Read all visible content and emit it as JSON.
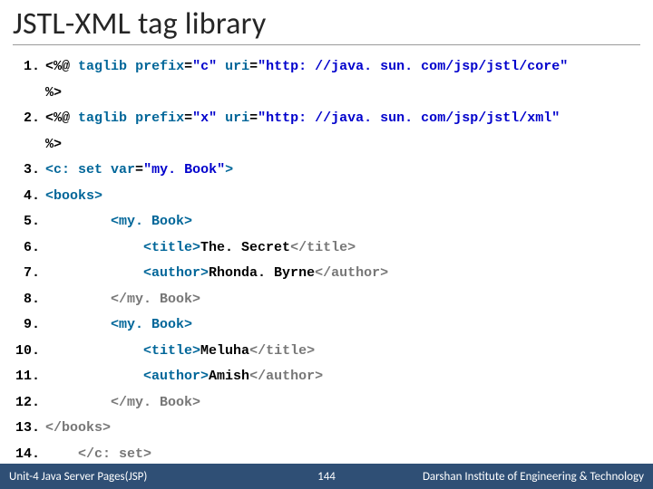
{
  "slide": {
    "title": "JSTL-XML tag library"
  },
  "code": {
    "lines": [
      {
        "n": "1.",
        "indent": 0,
        "segs": [
          {
            "t": "<%@",
            "c": "txt"
          },
          {
            "t": " ",
            "c": "txt"
          },
          {
            "t": "taglib",
            "c": "kw"
          },
          {
            "t": " ",
            "c": "txt"
          },
          {
            "t": "prefix",
            "c": "kw"
          },
          {
            "t": "=",
            "c": "txt"
          },
          {
            "t": "\"c\"",
            "c": "str"
          },
          {
            "t": " ",
            "c": "txt"
          },
          {
            "t": "uri",
            "c": "kw"
          },
          {
            "t": "=",
            "c": "txt"
          },
          {
            "t": "\"http: //java. sun. com/jsp/jstl/core\"",
            "c": "str"
          }
        ]
      },
      {
        "n": "",
        "indent": 0,
        "segs": [
          {
            "t": "%>",
            "c": "txt"
          }
        ]
      },
      {
        "n": "2.",
        "indent": 0,
        "segs": [
          {
            "t": "<%@",
            "c": "txt"
          },
          {
            "t": " ",
            "c": "txt"
          },
          {
            "t": "taglib",
            "c": "kw"
          },
          {
            "t": " ",
            "c": "txt"
          },
          {
            "t": "prefix",
            "c": "kw"
          },
          {
            "t": "=",
            "c": "txt"
          },
          {
            "t": "\"x\"",
            "c": "str"
          },
          {
            "t": " ",
            "c": "txt"
          },
          {
            "t": "uri",
            "c": "kw"
          },
          {
            "t": "=",
            "c": "txt"
          },
          {
            "t": "\"http: //java. sun. com/jsp/jstl/xml\"",
            "c": "str"
          }
        ]
      },
      {
        "n": "",
        "indent": 0,
        "segs": [
          {
            "t": "%>",
            "c": "txt"
          }
        ]
      },
      {
        "n": "3.",
        "indent": 0,
        "segs": [
          {
            "t": "<c: set",
            "c": "tag"
          },
          {
            "t": " ",
            "c": "txt"
          },
          {
            "t": "var",
            "c": "kw"
          },
          {
            "t": "=",
            "c": "txt"
          },
          {
            "t": "\"my. Book\"",
            "c": "str"
          },
          {
            "t": ">",
            "c": "tag"
          }
        ]
      },
      {
        "n": "4.",
        "indent": 0,
        "segs": [
          {
            "t": "<books>",
            "c": "tag"
          }
        ]
      },
      {
        "n": "5.",
        "indent": 2,
        "segs": [
          {
            "t": "<my. Book>",
            "c": "tag"
          }
        ]
      },
      {
        "n": "6.",
        "indent": 3,
        "segs": [
          {
            "t": "<title>",
            "c": "tag"
          },
          {
            "t": "The. Secret",
            "c": "txt"
          },
          {
            "t": "</title>",
            "c": "grey"
          }
        ]
      },
      {
        "n": "7.",
        "indent": 3,
        "segs": [
          {
            "t": "<author>",
            "c": "tag"
          },
          {
            "t": "Rhonda. Byrne",
            "c": "txt"
          },
          {
            "t": "</author>",
            "c": "grey"
          }
        ]
      },
      {
        "n": "8.",
        "indent": 2,
        "segs": [
          {
            "t": "</my. Book>",
            "c": "grey"
          }
        ]
      },
      {
        "n": "9.",
        "indent": 2,
        "segs": [
          {
            "t": "<my. Book>",
            "c": "tag"
          }
        ]
      },
      {
        "n": "10.",
        "indent": 3,
        "segs": [
          {
            "t": "<title>",
            "c": "tag"
          },
          {
            "t": "Meluha",
            "c": "txt"
          },
          {
            "t": "</title>",
            "c": "grey"
          }
        ]
      },
      {
        "n": "11.",
        "indent": 3,
        "segs": [
          {
            "t": "<author>",
            "c": "tag"
          },
          {
            "t": "Amish",
            "c": "txt"
          },
          {
            "t": "</author>",
            "c": "grey"
          }
        ]
      },
      {
        "n": "12.",
        "indent": 2,
        "segs": [
          {
            "t": "</my. Book>",
            "c": "grey"
          }
        ]
      },
      {
        "n": "13.",
        "indent": 0,
        "segs": [
          {
            "t": "</books>",
            "c": "grey"
          }
        ]
      },
      {
        "n": "14.",
        "indent": 1,
        "segs": [
          {
            "t": "</c: set>",
            "c": "grey"
          }
        ]
      }
    ]
  },
  "footer": {
    "left": "Unit-4 Java Server Pages(JSP)",
    "page": "144",
    "right": "Darshan Institute of Engineering & Technology"
  }
}
